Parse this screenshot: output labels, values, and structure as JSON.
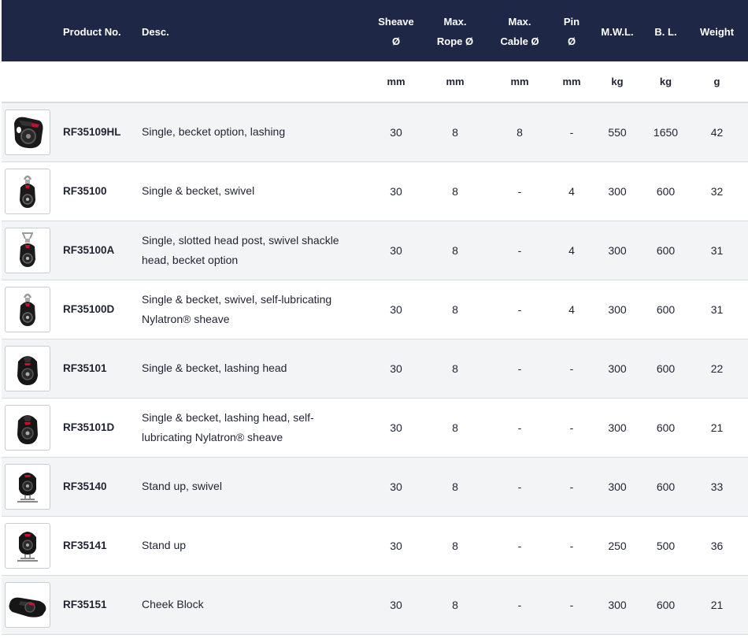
{
  "table": {
    "headers": {
      "product": "Product No.",
      "desc": "Desc.",
      "sheave_line1": "Sheave",
      "sheave_line2": "Ø",
      "rope_line1": "Max.",
      "rope_line2": "Rope Ø",
      "cable_line1": "Max.",
      "cable_line2": "Cable Ø",
      "pin_line1": "Pin",
      "pin_line2": "Ø",
      "mwl": "M.W.L.",
      "bl": "B. L.",
      "weight": "Weight"
    },
    "units": {
      "sheave": "mm",
      "rope": "mm",
      "cable": "mm",
      "pin": "mm",
      "mwl": "kg",
      "bl": "kg",
      "weight": "g"
    },
    "rows": [
      {
        "image_icon": "block-lashing-icon",
        "product": "RF35109HL",
        "desc": "Single, becket option, lashing",
        "sheave": "30",
        "rope": "8",
        "cable": "8",
        "pin": "-",
        "mwl": "550",
        "bl": "1650",
        "weight": "42"
      },
      {
        "image_icon": "block-swivel-icon",
        "product": "RF35100",
        "desc": "Single & becket, swivel",
        "sheave": "30",
        "rope": "8",
        "cable": "-",
        "pin": "4",
        "mwl": "300",
        "bl": "600",
        "weight": "32"
      },
      {
        "image_icon": "block-shackle-icon",
        "product": "RF35100A",
        "desc": "Single, slotted head post, swivel shackle head, becket option",
        "sheave": "30",
        "rope": "8",
        "cable": "-",
        "pin": "4",
        "mwl": "300",
        "bl": "600",
        "weight": "31"
      },
      {
        "image_icon": "block-swivel-icon",
        "product": "RF35100D",
        "desc": "Single & becket, swivel, self-lubricating Nylatron® sheave",
        "sheave": "30",
        "rope": "8",
        "cable": "-",
        "pin": "4",
        "mwl": "300",
        "bl": "600",
        "weight": "31"
      },
      {
        "image_icon": "block-lashing-head-icon",
        "product": "RF35101",
        "desc": "Single & becket, lashing head",
        "sheave": "30",
        "rope": "8",
        "cable": "-",
        "pin": "-",
        "mwl": "300",
        "bl": "600",
        "weight": "22"
      },
      {
        "image_icon": "block-lashing-head-icon",
        "product": "RF35101D",
        "desc": "Single & becket, lashing head, self-lubricating Nylatron® sheave",
        "sheave": "30",
        "rope": "8",
        "cable": "-",
        "pin": "-",
        "mwl": "300",
        "bl": "600",
        "weight": "21"
      },
      {
        "image_icon": "block-standup-icon",
        "product": "RF35140",
        "desc": "Stand up, swivel",
        "sheave": "30",
        "rope": "8",
        "cable": "-",
        "pin": "-",
        "mwl": "300",
        "bl": "600",
        "weight": "33"
      },
      {
        "image_icon": "block-standup-icon",
        "product": "RF35141",
        "desc": "Stand up",
        "sheave": "30",
        "rope": "8",
        "cable": "-",
        "pin": "-",
        "mwl": "250",
        "bl": "500",
        "weight": "36"
      },
      {
        "image_icon": "cheek-block-icon",
        "product": "RF35151",
        "desc": "Cheek Block",
        "sheave": "30",
        "rope": "8",
        "cable": "-",
        "pin": "-",
        "mwl": "300",
        "bl": "600",
        "weight": "21"
      }
    ]
  },
  "colors": {
    "header_bg": "#1e2745",
    "header_text": "#ffffff",
    "row_alt_bg": "#f3f4f6",
    "border": "#d9dbe0",
    "accent_red": "#c8102e"
  }
}
